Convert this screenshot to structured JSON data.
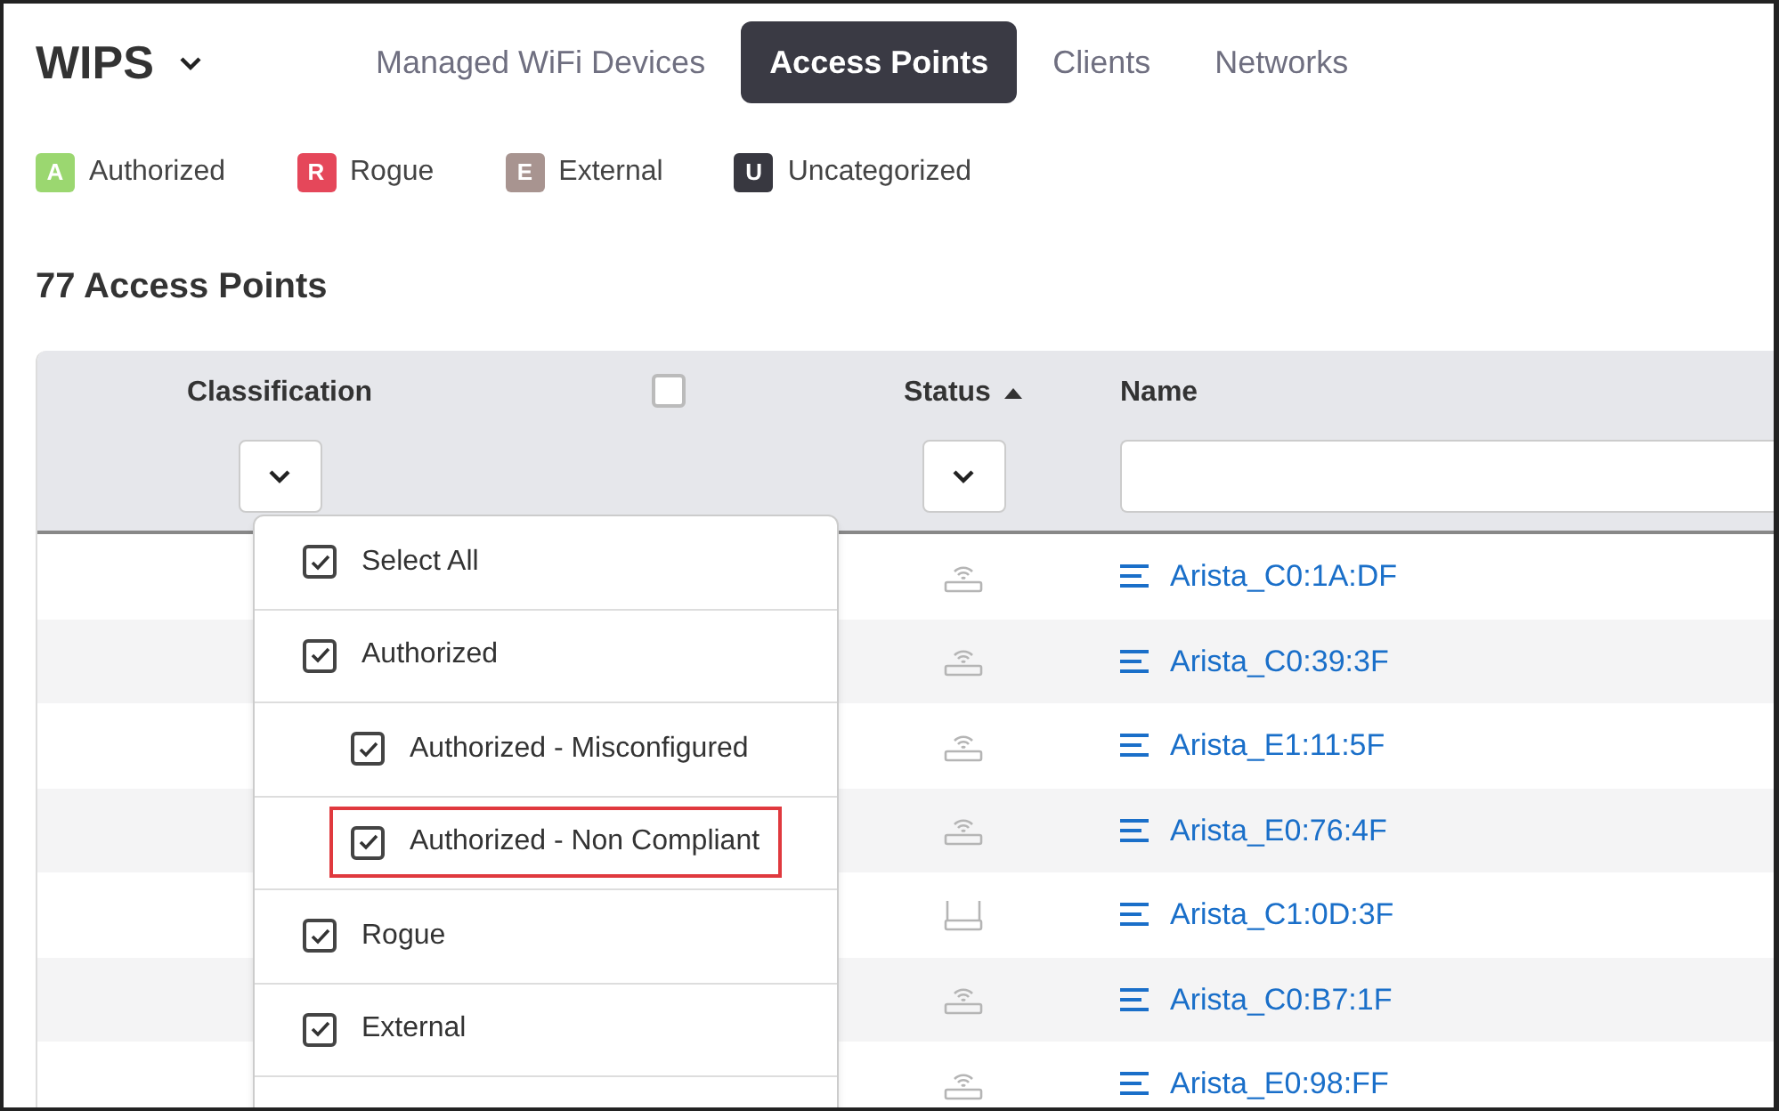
{
  "header": {
    "title": "WIPS"
  },
  "tabs": [
    {
      "label": "Managed WiFi Devices",
      "selected": false
    },
    {
      "label": "Access Points",
      "selected": true
    },
    {
      "label": "Clients",
      "selected": false
    },
    {
      "label": "Networks",
      "selected": false
    }
  ],
  "legend": [
    {
      "letter": "A",
      "label": "Authorized",
      "color": "#9bd770"
    },
    {
      "letter": "R",
      "label": "Rogue",
      "color": "#e5475a"
    },
    {
      "letter": "E",
      "label": "External",
      "color": "#a89490"
    },
    {
      "letter": "U",
      "label": "Uncategorized",
      "color": "#383840"
    }
  ],
  "count_title": "77 Access Points",
  "table": {
    "columns": [
      {
        "label": "Classification",
        "kind": "dropdown",
        "sorted": false
      },
      {
        "kind": "checkbox",
        "checked": false
      },
      {
        "label": "Status",
        "kind": "dropdown",
        "sorted": true
      },
      {
        "label": "Name",
        "kind": "text"
      }
    ],
    "rows": [
      {
        "kind": "ap",
        "name": "Arista_C0:1A:DF"
      },
      {
        "kind": "ap",
        "name": "Arista_C0:39:3F"
      },
      {
        "kind": "ap",
        "name": "Arista_E1:11:5F"
      },
      {
        "kind": "ap",
        "name": "Arista_E0:76:4F"
      },
      {
        "kind": "router",
        "name": "Arista_C1:0D:3F"
      },
      {
        "kind": "ap",
        "name": "Arista_C0:B7:1F"
      },
      {
        "kind": "ap",
        "name": "Arista_E0:98:FF"
      }
    ]
  },
  "classification_menu": {
    "items": [
      {
        "label": "Select All",
        "checked": true
      },
      {
        "label": "Authorized",
        "checked": true,
        "children": [
          {
            "label": "Authorized - Misconfigured",
            "checked": true,
            "highlighted": false
          },
          {
            "label": "Authorized - Non Compliant",
            "checked": true,
            "highlighted": true
          }
        ]
      },
      {
        "label": "Rogue",
        "checked": true
      },
      {
        "label": "External",
        "checked": true
      }
    ]
  }
}
